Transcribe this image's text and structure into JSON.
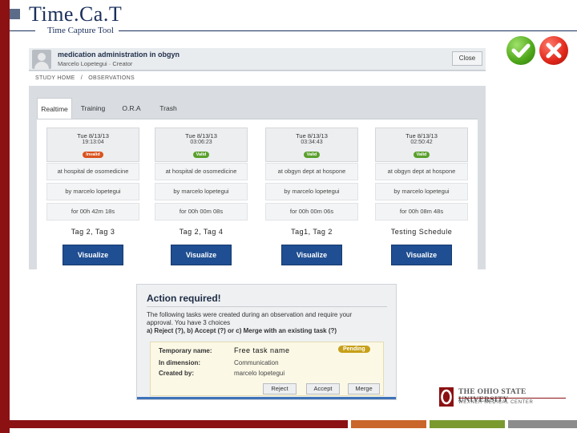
{
  "slide": {
    "title": "Time.Ca.T",
    "subtitle": "Time Capture Tool"
  },
  "app": {
    "observation_title": "medication administration in obgyn",
    "author_line": "Marcelo Lopetegui · Creator",
    "close_label": "Close",
    "breadcrumb": [
      "STUDY HOME",
      "/",
      "OBSERVATIONS"
    ],
    "tabs": [
      "Realtime",
      "Training",
      "O.R.A",
      "Trash"
    ],
    "cards": [
      {
        "date": "Tue 8/13/13",
        "time": "19:13:04",
        "badge": "Invalid",
        "badge_color": "#d9531e",
        "location": "at hospital de osomedicine",
        "by": "by marcelo lopetegui",
        "duration": "for 00h 42m 18s",
        "tags": "Tag 2, Tag 3",
        "button": "Visualize"
      },
      {
        "date": "Tue 8/13/13",
        "time": "03:06:23",
        "badge": "Valid",
        "badge_color": "#5aa02c",
        "location": "at hospital de osomedicine",
        "by": "by marcelo lopetegui",
        "duration": "for 00h 00m 08s",
        "tags": "Tag 2, Tag 4",
        "button": "Visualize"
      },
      {
        "date": "Tue 8/13/13",
        "time": "03:34:43",
        "badge": "Valid",
        "badge_color": "#5aa02c",
        "location": "at obgyn dept at hospone",
        "by": "by marcelo lopetegui",
        "duration": "for 00h 00m 06s",
        "tags": "Tag1, Tag 2",
        "button": "Visualize"
      },
      {
        "date": "Tue 8/13/13",
        "time": "02:50:42",
        "badge": "Valid",
        "badge_color": "#5aa02c",
        "location": "at obgyn dept at hospone",
        "by": "by marcelo lopetegui",
        "duration": "for 00h 08m 48s",
        "tags": "Testing Schedule",
        "button": "Visualize"
      }
    ]
  },
  "icons": {
    "approve": "check-icon",
    "reject": "x-icon"
  },
  "dialog": {
    "title": "Action required!",
    "line1": "The following tasks were created during an observation and require your",
    "line2": "approval. You have 3 choices",
    "line3": "a) Reject (?), b) Accept (?) or c) Merge with an existing task (?)",
    "temp_name_label": "Temporary name:",
    "temp_name_value": "Free task name",
    "status": "Pending",
    "dimension_label": "In dimension:",
    "dimension_value": "Communication",
    "created_label": "Created by:",
    "created_value": "marcelo lopetegui",
    "reject_label": "Reject",
    "accept_label": "Accept",
    "merge_label": "Merge"
  },
  "logo": {
    "name": "THE OHIO STATE UNIVERSITY",
    "sub": "WEXNER MEDICAL CENTER"
  },
  "colors": {
    "brand_red": "#8b1113",
    "title_blue": "#1a2f5a",
    "visualize_blue": "#1f4e92",
    "pending_gold": "#c7a018"
  }
}
